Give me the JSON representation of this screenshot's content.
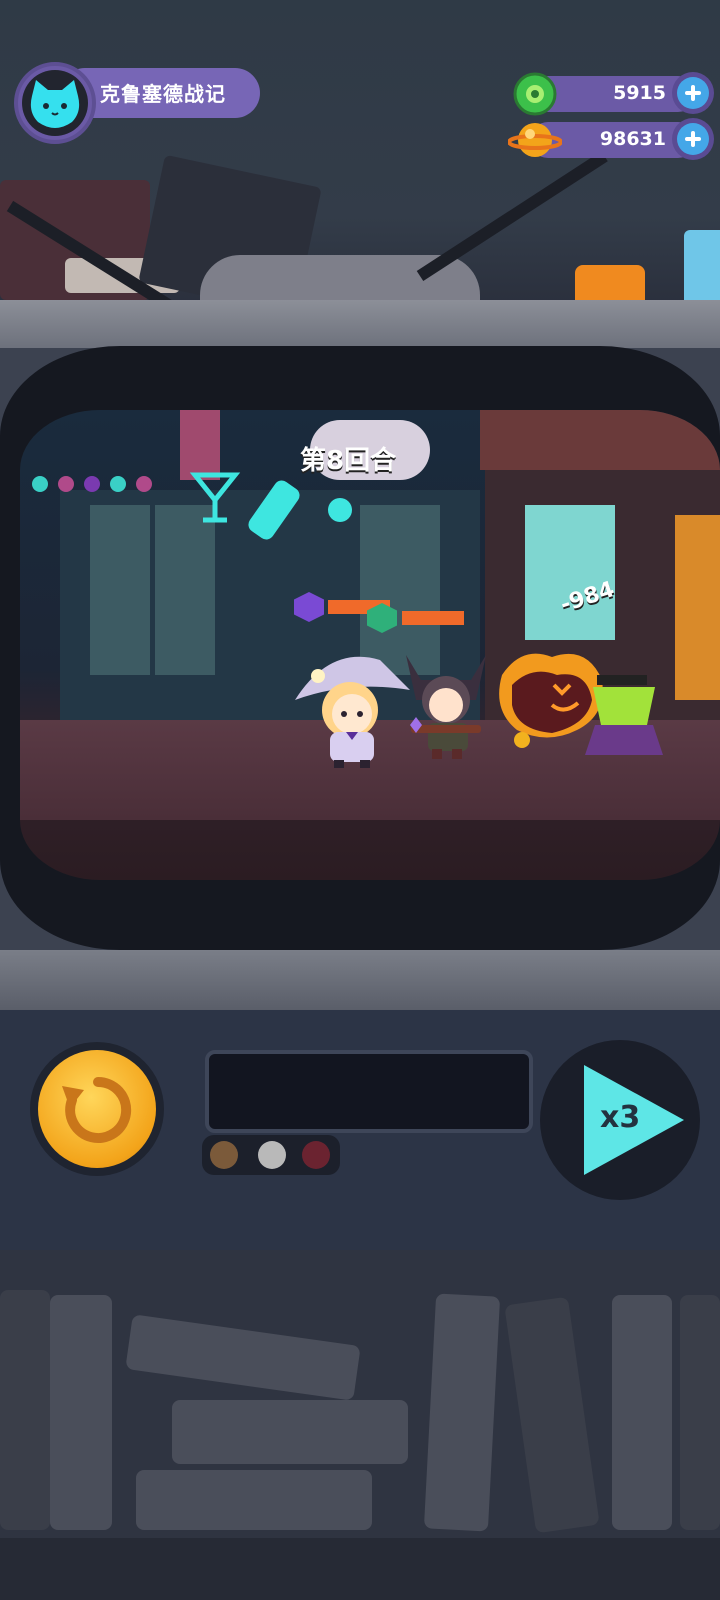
{
  "player": {
    "name": "克鲁塞德战记",
    "avatar_icon": "cat-face-icon"
  },
  "currencies": [
    {
      "icon": "green-gem-icon",
      "value": "5915",
      "color": "#3cc04a"
    },
    {
      "icon": "gold-planet-coin-icon",
      "value": "98631",
      "color": "#f3a41a"
    }
  ],
  "battle": {
    "round_label": "第8回合",
    "damage_popup": "-984",
    "heroes": [
      {
        "name": "witch-hero",
        "badge_color": "#7a4ad4",
        "hp_fraction": 1.0
      },
      {
        "name": "gunner-hero",
        "badge_color": "#2fb07a",
        "hp_fraction": 1.0
      }
    ],
    "enemies": [
      {
        "name": "fire-monster"
      },
      {
        "name": "poison-cauldron"
      }
    ]
  },
  "controls": {
    "restart_icon": "restart-icon",
    "speed_label": "x3",
    "tray_dots": [
      "#7b5a3a",
      "#b9b9b9",
      "#6b2330"
    ]
  },
  "colors": {
    "accent_purple": "#7766b6",
    "plus_blue": "#44a7e8",
    "speed_cyan": "#5ee6e6",
    "restart_gold": "#f3a41a"
  }
}
